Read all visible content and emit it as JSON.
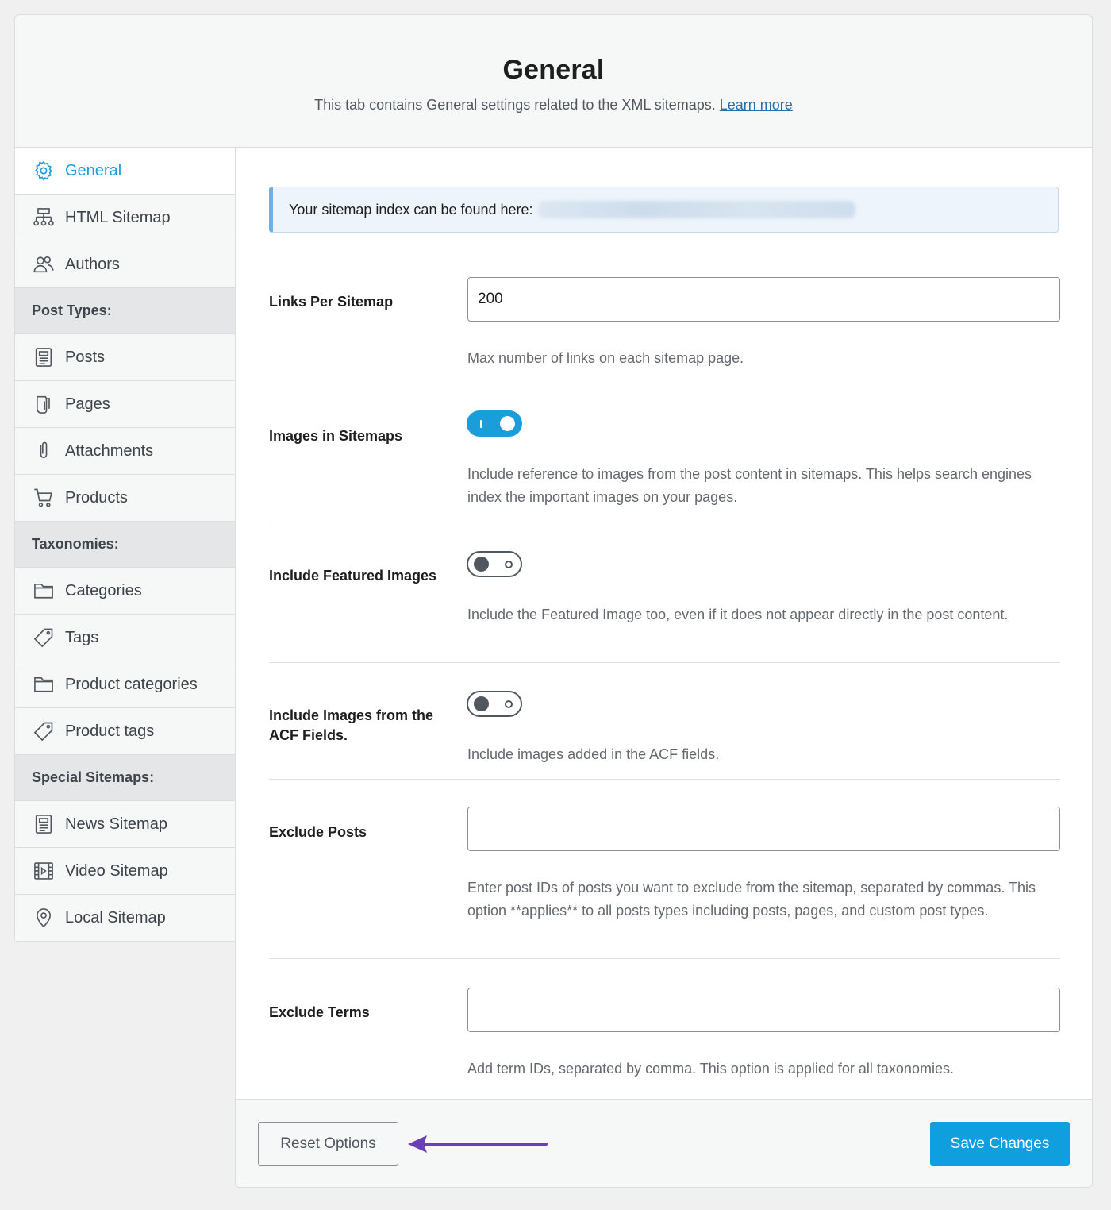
{
  "header": {
    "title": "General",
    "description": "This tab contains General settings related to the XML sitemaps.",
    "learn_more": "Learn more"
  },
  "sidebar": {
    "items": [
      {
        "label": "General",
        "icon": "gear-icon",
        "active": true
      },
      {
        "label": "HTML Sitemap",
        "icon": "sitemap-icon"
      },
      {
        "label": "Authors",
        "icon": "users-icon"
      },
      {
        "heading": "Post Types:"
      },
      {
        "label": "Posts",
        "icon": "post-icon"
      },
      {
        "label": "Pages",
        "icon": "page-icon"
      },
      {
        "label": "Attachments",
        "icon": "paperclip-icon"
      },
      {
        "label": "Products",
        "icon": "cart-icon"
      },
      {
        "heading": "Taxonomies:"
      },
      {
        "label": "Categories",
        "icon": "folder-icon"
      },
      {
        "label": "Tags",
        "icon": "tag-icon"
      },
      {
        "label": "Product categories",
        "icon": "folder-icon"
      },
      {
        "label": "Product tags",
        "icon": "tag-icon"
      },
      {
        "heading": "Special Sitemaps:"
      },
      {
        "label": "News Sitemap",
        "icon": "news-icon"
      },
      {
        "label": "Video Sitemap",
        "icon": "video-icon"
      },
      {
        "label": "Local Sitemap",
        "icon": "location-pin-icon"
      }
    ]
  },
  "notice": {
    "text": "Your sitemap index can be found here:"
  },
  "settings": {
    "links_per_sitemap": {
      "label": "Links Per Sitemap",
      "value": "200",
      "description": "Max number of links on each sitemap page."
    },
    "images_in_sitemaps": {
      "label": "Images in Sitemaps",
      "enabled": true,
      "description": "Include reference to images from the post content in sitemaps. This helps search engines index the important images on your pages."
    },
    "include_featured_images": {
      "label": "Include Featured Images",
      "enabled": false,
      "description": "Include the Featured Image too, even if it does not appear directly in the post content."
    },
    "include_acf_images": {
      "label": "Include Images from the ACF Fields.",
      "enabled": false,
      "description": "Include images added in the ACF fields."
    },
    "exclude_posts": {
      "label": "Exclude Posts",
      "value": "",
      "description": "Enter post IDs of posts you want to exclude from the sitemap, separated by commas. This option **applies** to all posts types including posts, pages, and custom post types."
    },
    "exclude_terms": {
      "label": "Exclude Terms",
      "value": "",
      "description": "Add term IDs, separated by comma. This option is applied for all taxonomies."
    }
  },
  "footer": {
    "reset_label": "Reset Options",
    "save_label": "Save Changes"
  },
  "colors": {
    "accent": "#1a9ddb",
    "annotation_arrow": "#6b3fb5"
  }
}
